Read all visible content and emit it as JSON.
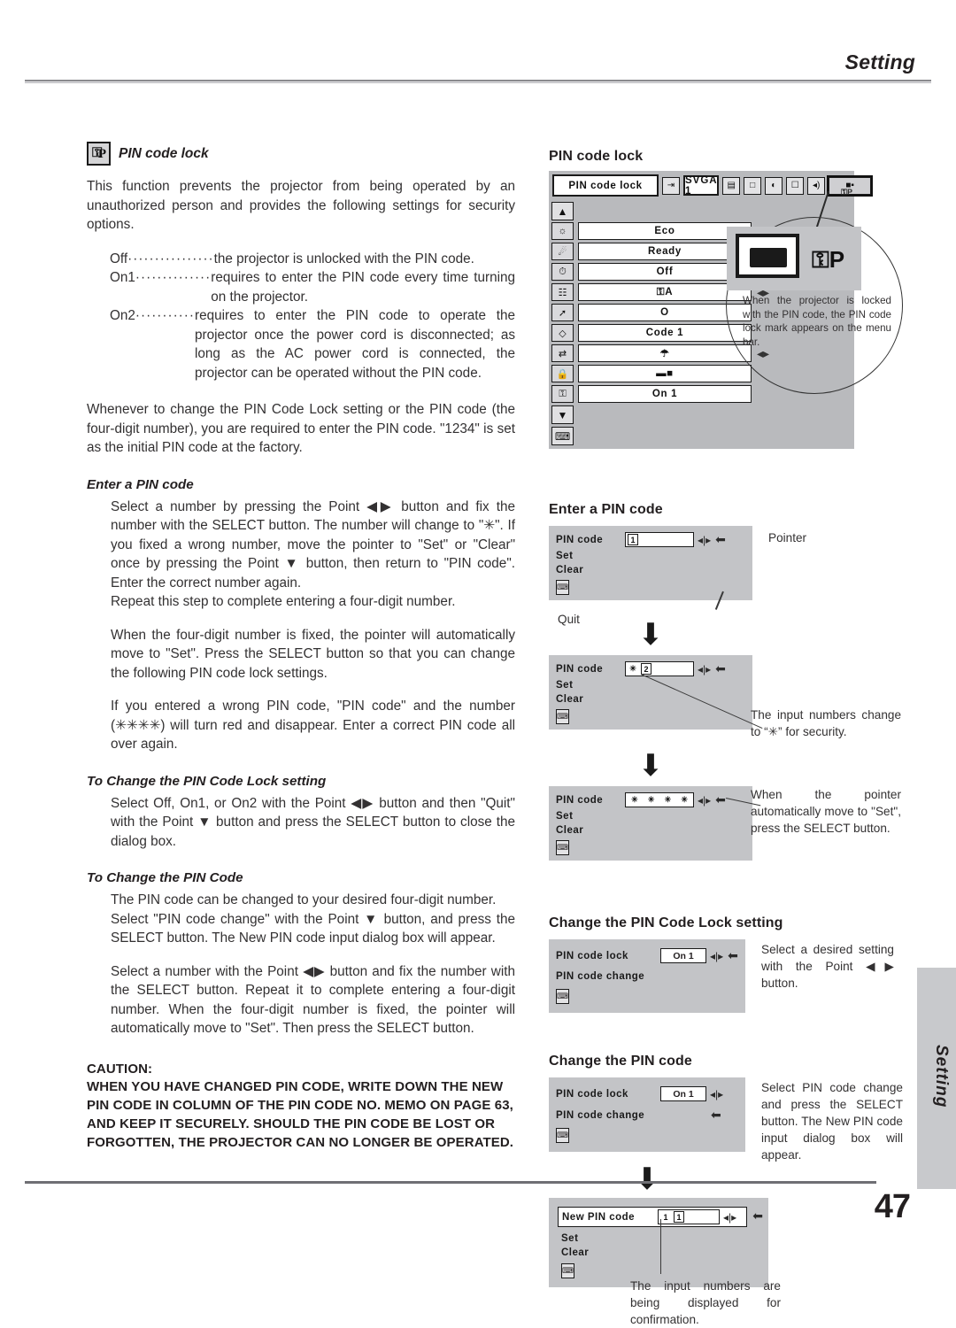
{
  "header": {
    "title": "Setting"
  },
  "footer": {
    "page_number": "47",
    "side_tab": "Setting"
  },
  "left": {
    "section_title": "PIN code lock",
    "badge_key": "⚿",
    "badge_p": "P",
    "intro": "This function prevents the projector from being operated by an unauthorized person and provides the following settings for security options.",
    "options": [
      {
        "term": "Off",
        "dots": "················",
        "desc": "the projector is unlocked with the PIN code."
      },
      {
        "term": "On1",
        "dots": "··············",
        "desc": "requires to enter the PIN code every time turning on the projector."
      },
      {
        "term": "On2",
        "dots": "···········",
        "desc": "requires to enter the PIN code to operate the projector once the power cord is disconnected; as long as the AC power cord is connected, the projector can be operated without the PIN code."
      }
    ],
    "whenever": "Whenever to change the PIN Code Lock setting or the PIN code (the four-digit number), you are required to enter the PIN code. \"1234\" is set as the initial PIN code at the factory.",
    "enter_head": "Enter a PIN code",
    "enter_p1": "Select a number by pressing the Point ◀▶ button and fix the number with the SELECT button.  The number will change to \"✳\".  If you fixed a wrong number, move the pointer to \"Set\" or \"Clear\" once by pressing the Point ▼ button, then return to \"PIN code\".  Enter the correct number again.",
    "enter_p2": "Repeat this step to complete entering a four-digit number.",
    "enter_p3": "When the four-digit number is fixed, the pointer will automatically move to \"Set\".  Press the SELECT button so that you can change the following PIN code lock settings.",
    "enter_p4": "If you entered a wrong PIN code, \"PIN code\" and the number (✳✳✳✳) will turn red and disappear.  Enter a correct PIN code all over again.",
    "change_lock_head": "To Change the PIN Code Lock setting",
    "change_lock_p": "Select Off, On1, or On2 with the Point ◀▶ button and then \"Quit\" with the Point ▼ button and press the SELECT button to close the dialog box.",
    "change_code_head": "To Change the PIN Code",
    "change_code_p1": "The PIN code can be changed to your desired four-digit number.",
    "change_code_p2": "Select \"PIN code change\" with the Point ▼ button, and press the SELECT button.  The New PIN code input dialog box will appear.",
    "change_code_p3": "Select a number with the Point ◀▶ button and fix the number with the SELECT button. Repeat it to complete entering a four-digit number.  When the four-digit number is fixed, the pointer will automatically move to \"Set\".  Then press the SELECT button.",
    "caution_head": "CAUTION:",
    "caution_body": "WHEN YOU HAVE CHANGED PIN CODE, WRITE DOWN THE NEW PIN CODE IN COLUMN OF THE PIN CODE NO. MEMO ON PAGE 63, AND KEEP IT SECURELY.  SHOULD THE PIN CODE BE LOST OR FORGOTTEN, THE PROJECTOR CAN NO LONGER BE OPERATED."
  },
  "right": {
    "menu_head": "PIN code lock",
    "menu_bar": {
      "title": "PIN code lock",
      "source_icon": "input-icon",
      "source_value": "SVGA 1",
      "icons": [
        "computer-icon",
        "screen-icon",
        "color-icon",
        "image-icon",
        "sound-icon",
        "setting-icon"
      ],
      "lock_mark": "⚿P"
    },
    "menu_rows": [
      {
        "icon": "lamp-off-icon",
        "value": "Eco",
        "adj": true
      },
      {
        "icon": "lamp-icon",
        "value": "Ready",
        "adj": false
      },
      {
        "icon": "lamp-counter-icon",
        "value": "Off",
        "adj": true
      },
      {
        "icon": "filter-icon",
        "value": "⚿A",
        "adj": true
      },
      {
        "icon": "pointer-icon",
        "value": "O",
        "adj": false
      },
      {
        "icon": "remote-code-icon",
        "value": "Code 1",
        "adj": false
      },
      {
        "icon": "usb-icon",
        "value": "☂",
        "adj": true
      },
      {
        "icon": "key-lock-icon",
        "value": "▬■",
        "adj": false
      },
      {
        "icon": "pin-lock-icon",
        "value": "On 1",
        "adj": false
      }
    ],
    "nav_up": "▲",
    "nav_down": "▼",
    "quit_icon": "quit-icon",
    "callout_text": "When the projector is locked with the PIN code, the PIN code lock mark appears on the menu bar.",
    "callout_key": "⚿P",
    "enter_head": "Enter a PIN code",
    "dialog1": {
      "label": "PIN code",
      "digits": [
        "1"
      ],
      "set": "Set",
      "clear": "Clear",
      "pointer_note": "Pointer",
      "quit_note": "Quit"
    },
    "dialog2": {
      "label": "PIN code",
      "digits": [
        "✳",
        "2"
      ],
      "set": "Set",
      "clear": "Clear",
      "note": "The input numbers change to “✳” for security."
    },
    "dialog3": {
      "label": "PIN code",
      "digits": [
        "✳",
        "✳",
        "✳",
        "✳"
      ],
      "set": "Set",
      "clear": "Clear",
      "note": "When the pointer automatically move to \"Set\", press the SELECT button."
    },
    "change_lock_head": "Change the PIN Code Lock setting",
    "dialog4": {
      "row1_label": "PIN code lock",
      "row1_value": "On 1",
      "row2_label": "PIN code change",
      "note": "Select a desired setting with the Point ◀▶ button."
    },
    "change_code_head": "Change the PIN code",
    "dialog5": {
      "row1_label": "PIN code lock",
      "row1_value": "On 1",
      "row2_label": "PIN code change",
      "note": "Select PIN code change and press the SELECT button. The New PIN code input dialog box will appear."
    },
    "dialog6": {
      "label": "New PIN code",
      "digits": [
        "1",
        "1"
      ],
      "set": "Set",
      "clear": "Clear",
      "note": "The input numbers are being displayed for confirmation."
    },
    "arrow_glyph": "⬇"
  }
}
